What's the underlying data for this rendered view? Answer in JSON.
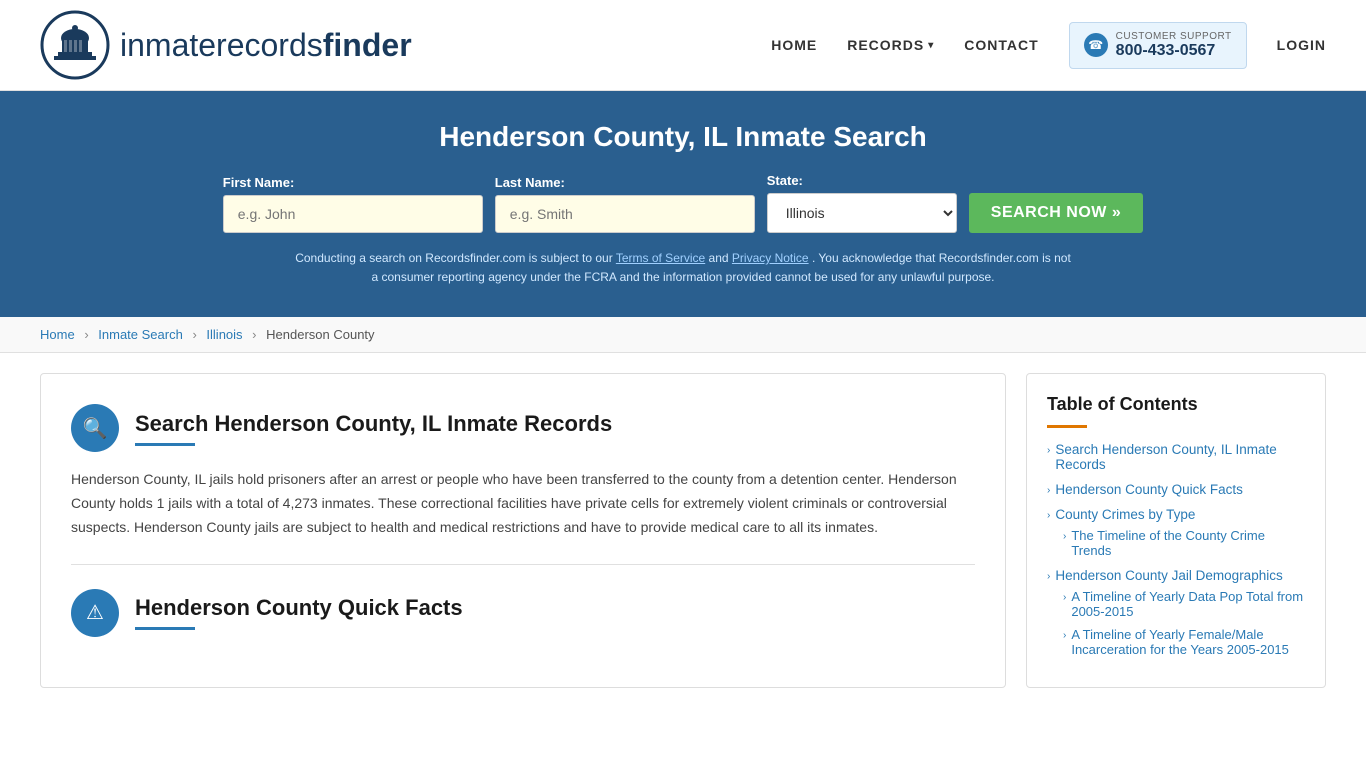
{
  "header": {
    "logo_text_normal": "inmaterecords",
    "logo_text_bold": "finder",
    "nav": {
      "home": "HOME",
      "records": "RECORDS",
      "contact": "CONTACT",
      "login": "LOGIN"
    },
    "support": {
      "label": "CUSTOMER SUPPORT",
      "number": "800-433-0567"
    }
  },
  "hero": {
    "title": "Henderson County, IL Inmate Search",
    "first_name_label": "First Name:",
    "first_name_placeholder": "e.g. John",
    "last_name_label": "Last Name:",
    "last_name_placeholder": "e.g. Smith",
    "state_label": "State:",
    "state_value": "Illinois",
    "search_button": "SEARCH NOW »",
    "disclaimer_text": "Conducting a search on Recordsfinder.com is subject to our",
    "terms_link": "Terms of Service",
    "disclaimer_and": "and",
    "privacy_link": "Privacy Notice",
    "disclaimer_rest": ". You acknowledge that Recordsfinder.com is not a consumer reporting agency under the FCRA and the information provided cannot be used for any unlawful purpose."
  },
  "breadcrumb": {
    "home": "Home",
    "inmate_search": "Inmate Search",
    "state": "Illinois",
    "county": "Henderson County"
  },
  "main_section": {
    "search_icon": "🔍",
    "search_title": "Search Henderson County, IL Inmate Records",
    "search_text": "Henderson County, IL jails hold prisoners after an arrest or people who have been transferred to the county from a detention center. Henderson County holds 1 jails with a total of 4,273 inmates. These correctional facilities have private cells for extremely violent criminals or controversial suspects. Henderson County jails are subject to health and medical restrictions and have to provide medical care to all its inmates.",
    "quickfacts_icon": "⚠",
    "quickfacts_title": "Henderson County Quick Facts"
  },
  "toc": {
    "title": "Table of Contents",
    "items": [
      {
        "label": "Search Henderson County, IL Inmate Records",
        "sub": []
      },
      {
        "label": "Henderson County Quick Facts",
        "sub": []
      },
      {
        "label": "County Crimes by Type",
        "sub": []
      },
      {
        "label": "The Timeline of the County Crime Trends",
        "sub": [],
        "indent": true
      },
      {
        "label": "Henderson County Jail Demographics",
        "sub": []
      },
      {
        "label": "A Timeline of Yearly Data Pop Total from 2005-2015",
        "sub": [],
        "indent": true
      },
      {
        "label": "A Timeline of Yearly Female/Male Incarceration for the Years 2005-2015",
        "sub": [],
        "indent": true
      }
    ]
  }
}
